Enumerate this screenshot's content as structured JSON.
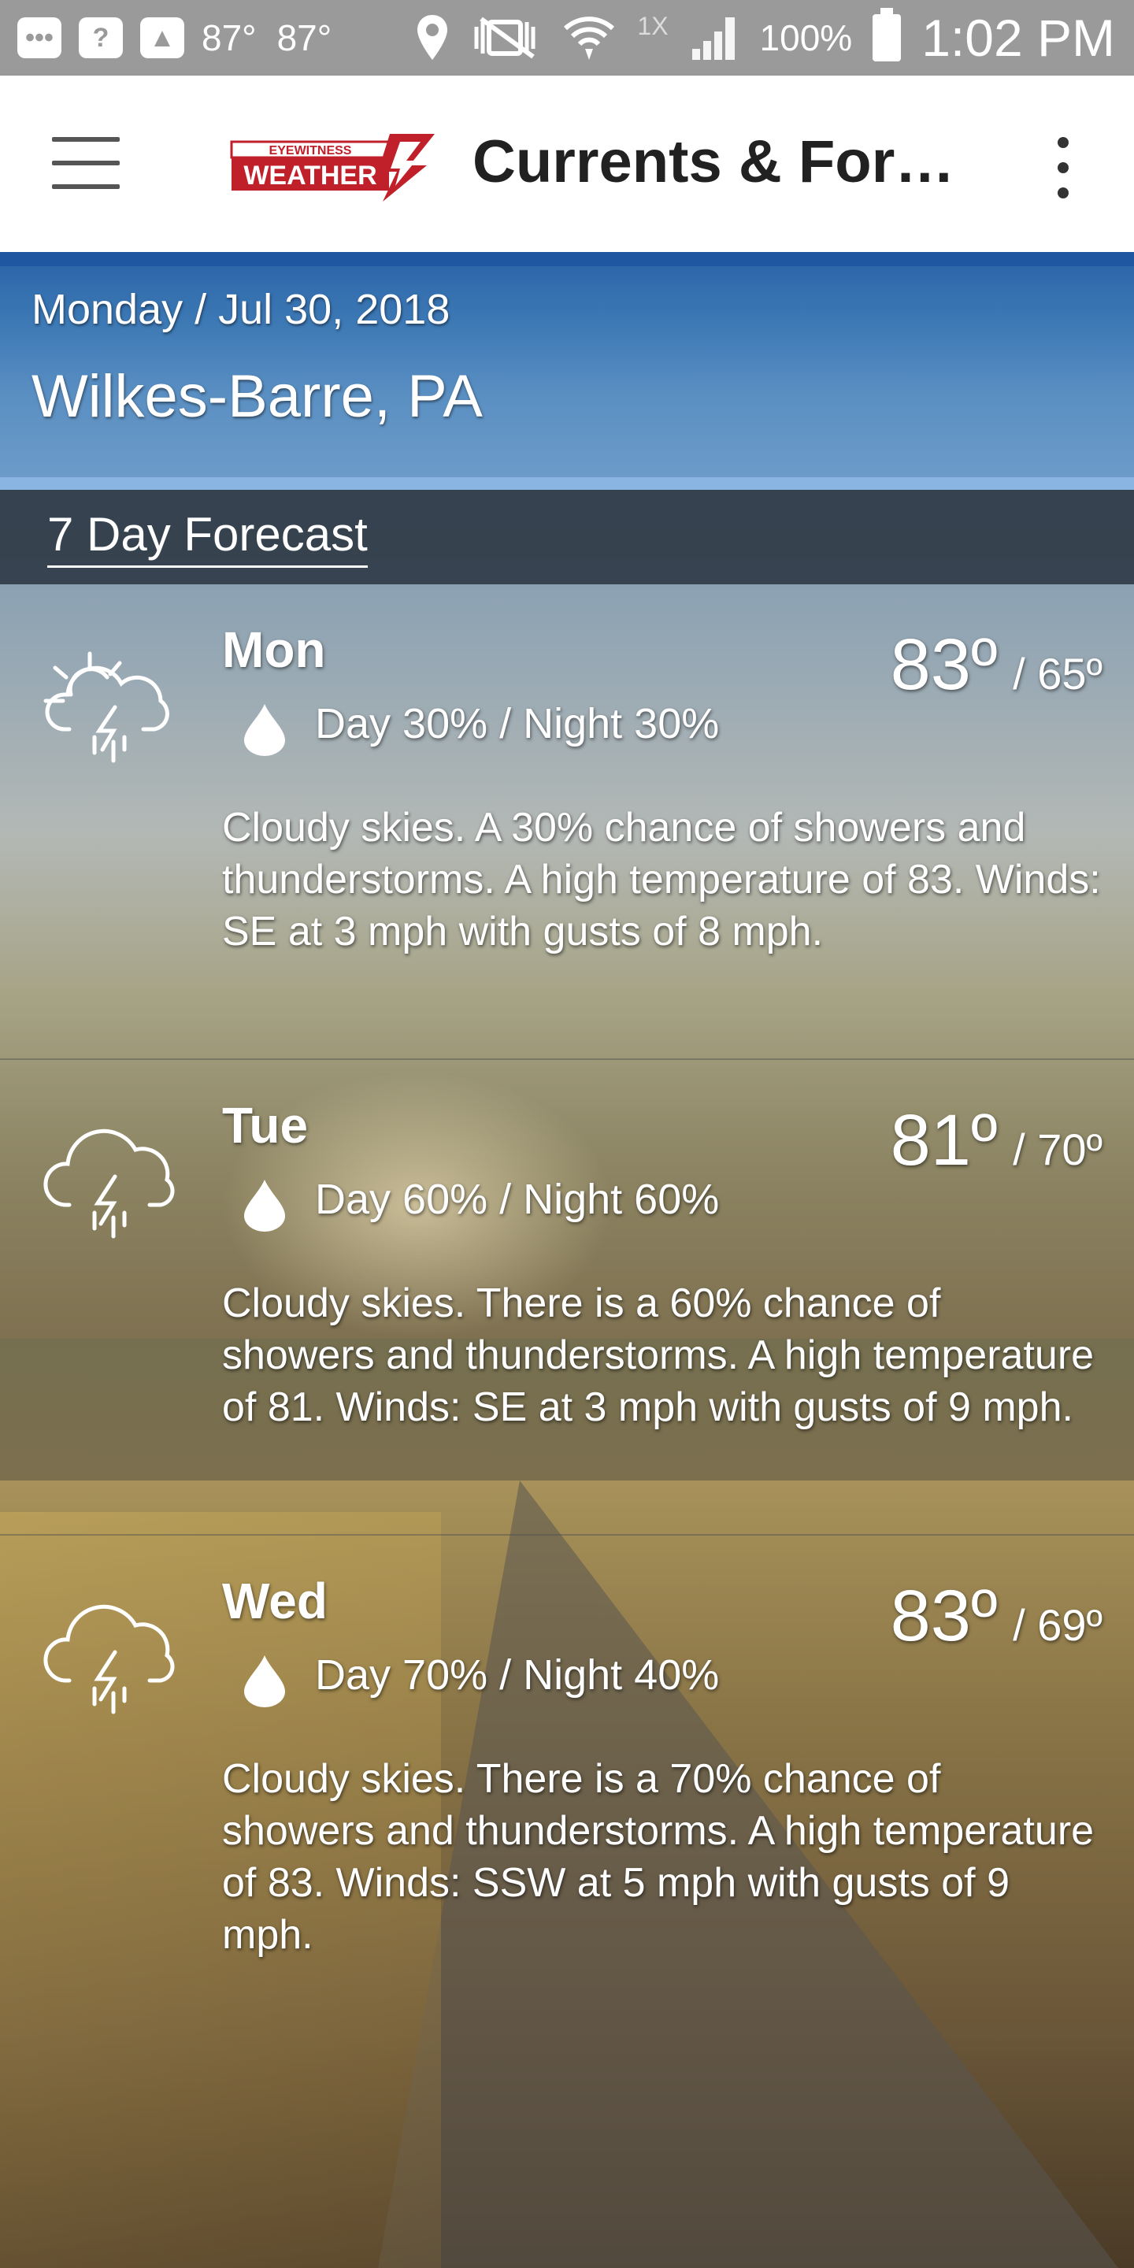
{
  "status_bar": {
    "temp1": "87°",
    "temp2": "87°",
    "network_label": "1X",
    "battery": "100%",
    "time": "1:02 PM"
  },
  "app_bar": {
    "logo_text_top": "EYEWITNESS",
    "logo_text_main": "WEATHER",
    "title": "Currents & Fore..."
  },
  "header": {
    "date": "Monday / Jul 30, 2018",
    "location": "Wilkes-Barre, PA"
  },
  "section": {
    "title": "7 Day Forecast"
  },
  "forecast": [
    {
      "day": "Mon",
      "icon": "partly-sunny-thunderstorm-icon",
      "precip": "Day 30% / Night 30%",
      "high": "83º",
      "low": "65º",
      "description": "Cloudy skies.  A 30% chance of showers and thunderstorms.  A high temperature of 83.  Winds: SE at 3 mph with gusts of 8 mph."
    },
    {
      "day": "Tue",
      "icon": "thunderstorm-icon",
      "precip": "Day 60% / Night 60%",
      "high": "81º",
      "low": "70º",
      "description": "Cloudy skies. There is a 60% chance of showers and thunderstorms.  A high temperature of 81.  Winds: SE at 3 mph with gusts of 9 mph."
    },
    {
      "day": "Wed",
      "icon": "thunderstorm-icon",
      "precip": "Day 70% / Night 40%",
      "high": "83º",
      "low": "69º",
      "description": "Cloudy skies. There is a 70% chance of showers and thunderstorms.  A high temperature of 83.  Winds: SSW at 5 mph with gusts of 9 mph."
    }
  ]
}
